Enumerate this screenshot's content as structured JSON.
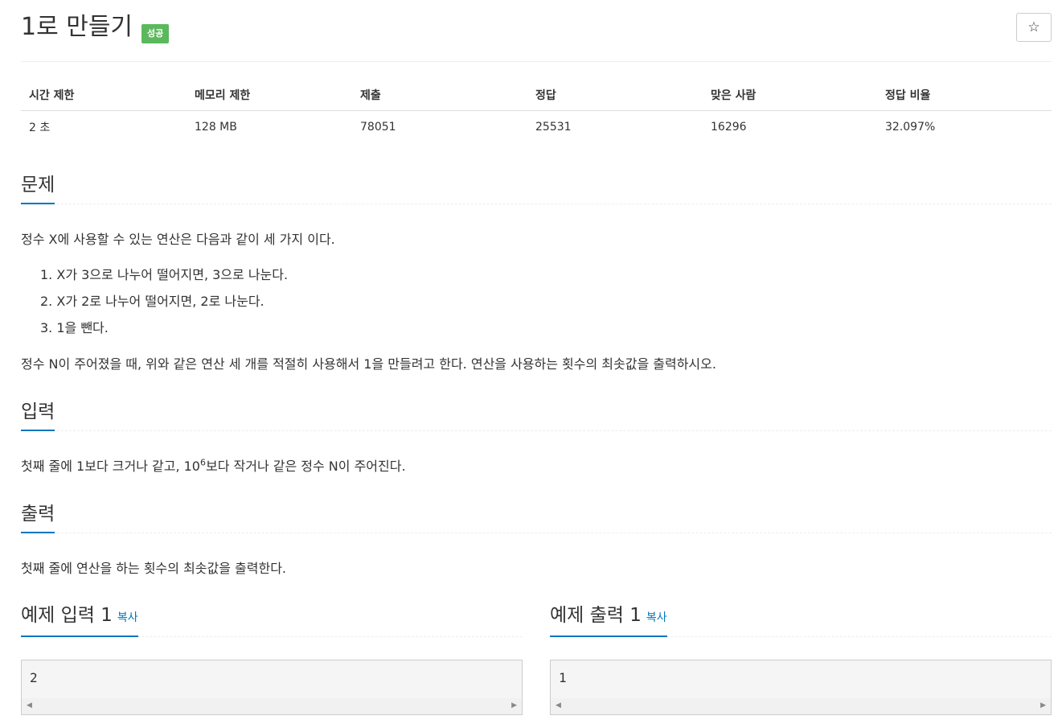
{
  "problem": {
    "title": "1로 만들기",
    "status_badge": "성공",
    "star_icon": "☆"
  },
  "info_table": {
    "headers": [
      "시간 제한",
      "메모리 제한",
      "제출",
      "정답",
      "맞은 사람",
      "정답 비율"
    ],
    "values": [
      "2 초",
      "128 MB",
      "78051",
      "25531",
      "16296",
      "32.097%"
    ]
  },
  "sections": {
    "description": {
      "title": "문제",
      "intro": "정수 X에 사용할 수 있는 연산은 다음과 같이 세 가지 이다.",
      "operations": [
        "1. X가 3으로 나누어 떨어지면, 3으로 나눈다.",
        "2. X가 2로 나누어 떨어지면, 2로 나눈다.",
        "3. 1을 뺀다."
      ],
      "task": "정수 N이 주어졌을 때, 위와 같은 연산 세 개를 적절히 사용해서 1을 만들려고 한다. 연산을 사용하는 횟수의 최솟값을 출력하시오."
    },
    "input": {
      "title": "입력",
      "text_before": "첫째 줄에 1보다 크거나 같고, 10",
      "superscript": "6",
      "text_after": "보다 작거나 같은 정수 N이 주어진다."
    },
    "output": {
      "title": "출력",
      "text": "첫째 줄에 연산을 하는 횟수의 최솟값을 출력한다."
    }
  },
  "samples": {
    "input": {
      "title": "예제 입력 1",
      "copy_label": "복사",
      "value": "2"
    },
    "output": {
      "title": "예제 출력 1",
      "copy_label": "복사",
      "value": "1"
    }
  },
  "colors": {
    "accent": "#0076c0",
    "success": "#5cb85c"
  }
}
